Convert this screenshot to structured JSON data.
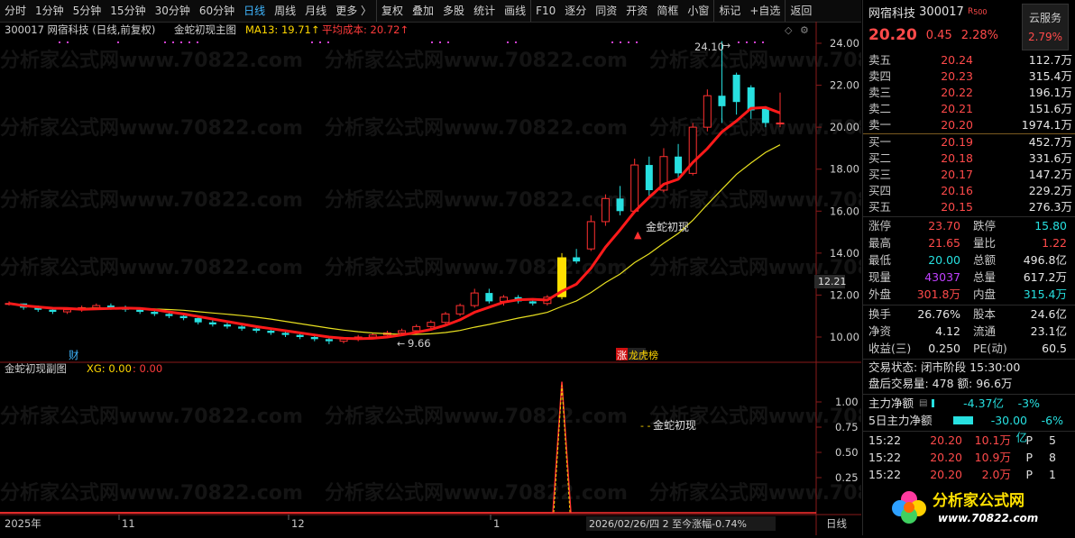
{
  "toolbar": {
    "items": [
      "分时",
      "1分钟",
      "5分钟",
      "15分钟",
      "30分钟",
      "60分钟",
      "日线",
      "周线",
      "月线",
      "更多 〉",
      "复权",
      "叠加",
      "多股",
      "统计",
      "画线",
      "F10",
      "逐分",
      "同资",
      "开资",
      "简框",
      "小窗",
      "标记",
      "+自选",
      "返回"
    ],
    "active_index": 6
  },
  "main_header": {
    "code_name": "300017  网宿科技 (日线,前复权)",
    "indicator_name": "金蛇初现主图",
    "ma_label": "MA13: 19.71↑",
    "avg_cost": "平均成本: 20.72↑"
  },
  "sub_header": {
    "indicator_name": "金蛇初现副图",
    "xg_label": "XG: 0.00",
    "xg_value": ": 0.00"
  },
  "watermark": "分析家公式网www.70822.com",
  "annotations": {
    "high_label": "24.10",
    "low_label": "9.66",
    "signal_label": "金蛇初现",
    "sub_signal_label": "金蛇初现",
    "cai_marker": "财",
    "zhang_marker": "涨",
    "list_marker": "龙虎榜",
    "price_tag": "12.21"
  },
  "price_axis": [
    "24.00",
    "22.00",
    "20.00",
    "18.00",
    "16.00",
    "14.00",
    "12.00",
    "10.00"
  ],
  "sub_axis": [
    "1.00",
    "0.75",
    "0.50",
    "0.25"
  ],
  "date_axis": {
    "labels": [
      "2025年",
      "11",
      "12",
      "1"
    ],
    "cursor": "2026/02/26/四 2 至今涨幅-0.74%",
    "period": "日线"
  },
  "chart_data": {
    "type": "candlestick",
    "title": "300017 网宿科技 (日线,前复权)",
    "ylim": [
      9.0,
      24.8
    ],
    "candles": [
      [
        11.6,
        11.7,
        11.5,
        11.6
      ],
      [
        11.6,
        11.6,
        11.3,
        11.4
      ],
      [
        11.4,
        11.5,
        11.2,
        11.3
      ],
      [
        11.3,
        11.4,
        11.1,
        11.2
      ],
      [
        11.2,
        11.4,
        11.1,
        11.3
      ],
      [
        11.3,
        11.5,
        11.2,
        11.4
      ],
      [
        11.4,
        11.6,
        11.3,
        11.5
      ],
      [
        11.5,
        11.6,
        11.3,
        11.4
      ],
      [
        11.4,
        11.5,
        11.2,
        11.3
      ],
      [
        11.3,
        11.4,
        11.1,
        11.2
      ],
      [
        11.2,
        11.3,
        11.0,
        11.1
      ],
      [
        11.1,
        11.2,
        10.9,
        11.0
      ],
      [
        11.0,
        11.1,
        10.8,
        10.9
      ],
      [
        10.9,
        11.0,
        10.6,
        10.7
      ],
      [
        10.7,
        10.8,
        10.5,
        10.6
      ],
      [
        10.6,
        10.7,
        10.4,
        10.5
      ],
      [
        10.5,
        10.6,
        10.3,
        10.4
      ],
      [
        10.4,
        10.5,
        10.2,
        10.3
      ],
      [
        10.3,
        10.4,
        10.1,
        10.2
      ],
      [
        10.2,
        10.3,
        10.0,
        10.1
      ],
      [
        10.1,
        10.2,
        9.9,
        10.0
      ],
      [
        10.0,
        10.1,
        9.8,
        9.9
      ],
      [
        9.9,
        10.0,
        9.66,
        9.8
      ],
      [
        9.8,
        10.0,
        9.7,
        9.9
      ],
      [
        9.9,
        10.1,
        9.8,
        10.0
      ],
      [
        10.0,
        10.2,
        9.9,
        10.1
      ],
      [
        10.1,
        10.3,
        10.0,
        10.2
      ],
      [
        10.2,
        10.4,
        10.1,
        10.3
      ],
      [
        10.3,
        10.6,
        10.2,
        10.5
      ],
      [
        10.5,
        10.8,
        10.4,
        10.7
      ],
      [
        10.7,
        11.2,
        10.6,
        11.1
      ],
      [
        11.1,
        11.6,
        11.0,
        11.5
      ],
      [
        11.5,
        12.3,
        11.4,
        12.1
      ],
      [
        12.1,
        12.3,
        11.6,
        11.7
      ],
      [
        11.7,
        12.0,
        11.5,
        11.9
      ],
      [
        11.9,
        12.0,
        11.6,
        11.7
      ],
      [
        11.7,
        11.8,
        11.5,
        11.6
      ],
      [
        11.6,
        12.0,
        11.5,
        11.9
      ],
      [
        11.9,
        14.0,
        11.8,
        13.8
      ],
      [
        13.8,
        14.2,
        13.5,
        13.6
      ],
      [
        14.2,
        15.8,
        14.1,
        15.5
      ],
      [
        15.5,
        16.8,
        15.3,
        16.6
      ],
      [
        16.6,
        17.2,
        15.8,
        16.0
      ],
      [
        16.0,
        18.5,
        15.9,
        18.2
      ],
      [
        18.2,
        18.6,
        16.7,
        17.0
      ],
      [
        17.0,
        19.0,
        16.9,
        18.6
      ],
      [
        18.6,
        19.2,
        17.5,
        17.8
      ],
      [
        17.8,
        20.2,
        17.7,
        20.0
      ],
      [
        20.0,
        21.8,
        19.8,
        21.5
      ],
      [
        21.5,
        24.1,
        20.2,
        21.0
      ],
      [
        22.5,
        22.6,
        20.6,
        21.2
      ],
      [
        21.9,
        22.0,
        20.4,
        20.8
      ],
      [
        20.9,
        21.0,
        20.0,
        20.2
      ],
      [
        20.2,
        21.65,
        20.0,
        20.2
      ]
    ],
    "series": [
      {
        "name": "MA13",
        "last": "19.71"
      },
      {
        "name": "平均成本",
        "last": "20.72"
      }
    ],
    "sub_series": {
      "name": "XG",
      "peak": 1.2
    }
  },
  "quote": {
    "name": "网宿科技",
    "code": "300017",
    "r_tag": "R",
    "cloud_label": "云服务",
    "cloud_pct": "2.79%",
    "price": "20.20",
    "change": "0.45",
    "change_pct": "2.28%",
    "asks": [
      {
        "label": "卖五",
        "price": "20.24",
        "vol": "112.7万"
      },
      {
        "label": "卖四",
        "price": "20.23",
        "vol": "315.4万"
      },
      {
        "label": "卖三",
        "price": "20.22",
        "vol": "196.1万"
      },
      {
        "label": "卖二",
        "price": "20.21",
        "vol": "151.6万"
      },
      {
        "label": "卖一",
        "price": "20.20",
        "vol": "1974.1万"
      }
    ],
    "bids": [
      {
        "label": "买一",
        "price": "20.19",
        "vol": "452.7万"
      },
      {
        "label": "买二",
        "price": "20.18",
        "vol": "331.6万"
      },
      {
        "label": "买三",
        "price": "20.17",
        "vol": "147.2万"
      },
      {
        "label": "买四",
        "price": "20.16",
        "vol": "229.2万"
      },
      {
        "label": "买五",
        "price": "20.15",
        "vol": "276.3万"
      }
    ],
    "stats1": [
      [
        "涨停",
        "23.70",
        "跌停",
        "15.80"
      ],
      [
        "最高",
        "21.65",
        "量比",
        "1.22"
      ],
      [
        "最低",
        "20.00",
        "总额",
        "496.8亿"
      ],
      [
        "现量",
        "43037",
        "总量",
        "617.2万"
      ],
      [
        "外盘",
        "301.8万",
        "内盘",
        "315.4万"
      ]
    ],
    "stats2": [
      [
        "换手",
        "26.76%",
        "股本",
        "24.6亿"
      ],
      [
        "净资",
        "4.12",
        "流通",
        "23.1亿"
      ],
      [
        "收益(三)",
        "0.250",
        "PE(动)",
        "60.5"
      ]
    ],
    "trade_status": "交易状态: 闭市阶段 15:30:00",
    "after_hours": "盘后交易量: 478  额: 96.6万",
    "main_flow_label": "主力净额",
    "main_flow_val": "-4.37亿",
    "main_flow_pct": "-3%",
    "flow5_label": "5日主力净额",
    "flow5_val": "-30.00亿",
    "flow5_pct": "-6%",
    "ticks": [
      [
        "15:22",
        "20.20",
        "10.1万",
        "P",
        "5"
      ],
      [
        "15:22",
        "20.20",
        "10.9万",
        "P",
        "8"
      ],
      [
        "15:22",
        "20.20",
        "2.0万",
        "P",
        "1"
      ]
    ],
    "logo_text": "分析家公式网",
    "logo_url": "www.70822.com"
  }
}
